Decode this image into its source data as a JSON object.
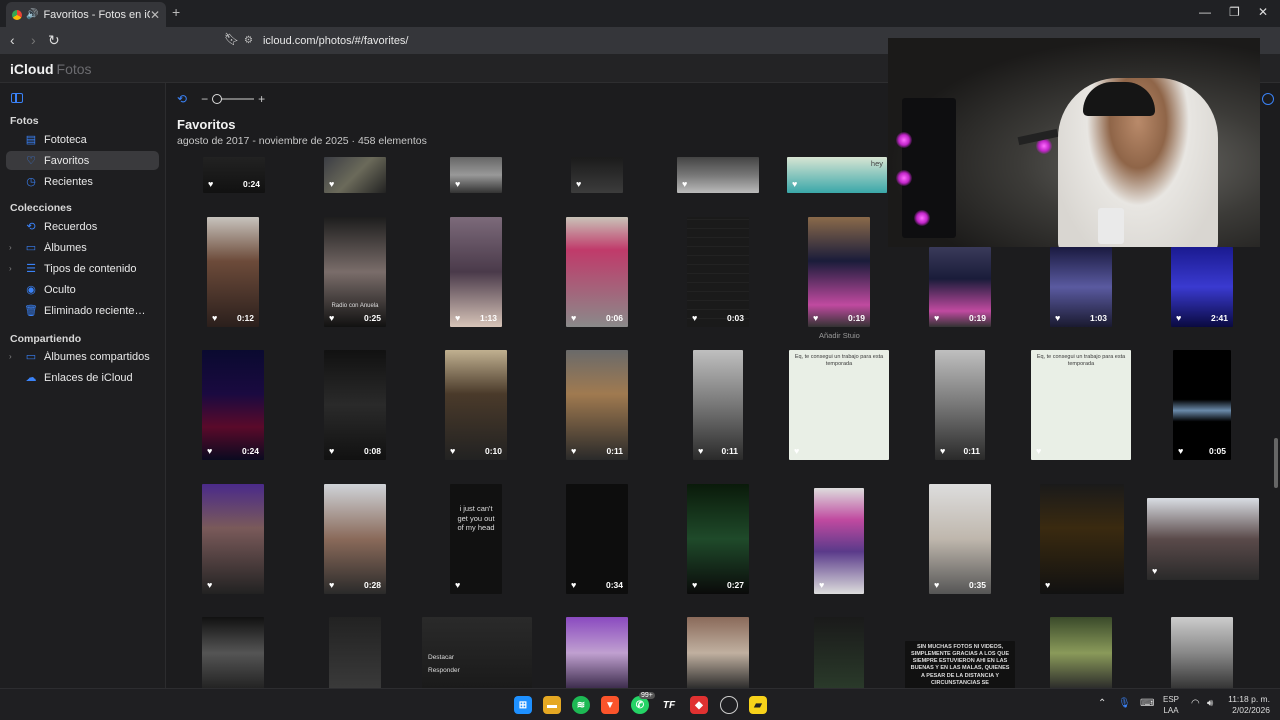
{
  "browser": {
    "tab_title": "Favoritos - Fotos en iCloud",
    "url": "icloud.com/photos/#/favorites/",
    "new_tab": "+",
    "win_min": "—",
    "win_restore": "❐",
    "win_close": "✕"
  },
  "app": {
    "brand": "iCloud",
    "brand_sub": "Fotos"
  },
  "sidebar": {
    "section_fotos": "Fotos",
    "section_colecciones": "Colecciones",
    "section_compartiendo": "Compartiendo",
    "items": [
      {
        "label": "Fototeca",
        "icon": "library-icon"
      },
      {
        "label": "Favoritos",
        "icon": "heart-icon"
      },
      {
        "label": "Recientes",
        "icon": "clock-icon"
      },
      {
        "label": "Recuerdos",
        "icon": "memories-icon"
      },
      {
        "label": "Álbumes",
        "icon": "album-icon"
      },
      {
        "label": "Tipos de contenido",
        "icon": "content-types-icon"
      },
      {
        "label": "Oculto",
        "icon": "eye-slash-icon"
      },
      {
        "label": "Eliminado recienteme...",
        "icon": "trash-icon"
      },
      {
        "label": "Álbumes compartidos",
        "icon": "shared-album-icon"
      },
      {
        "label": "Enlaces de iCloud",
        "icon": "cloud-link-icon"
      }
    ]
  },
  "main": {
    "title": "Favoritos",
    "subtitle": "agosto de 2017 - noviembre de 2025  ·  458 elementos",
    "hover_label": "Añadir Stuio",
    "zoom_minus": "−",
    "zoom_plus": "+",
    "heart": "♥",
    "durations": [
      "0:24",
      "0:12",
      "0:25",
      "1:13",
      "0:06",
      "0:03",
      "0:19",
      "0:19",
      "1:03",
      "2:41",
      "0:24",
      "0:08",
      "0:10",
      "0:11",
      "0:11",
      "0:11",
      "0:05",
      "0:28",
      "0:34",
      "0:27",
      "0:35"
    ],
    "thumb_texts": {
      "chat_heading": "Eq, te consegui un trabajo para esta temporada",
      "song_lyric": "i just can't get you out of my head",
      "caption_banner": "SIN MUCHAS FOTOS NI VIDEOS, SIMPLEMENTE GRACIAS A LOS QUE SIEMPRE ESTUVIERON AHI EN LAS BUENAS Y EN LAS MALAS, QUIENES A PESAR DE LA DISTANCIA Y CIRCUNSTANCIAS SE",
      "menu_destacar": "Destacar",
      "menu_responder": "Responder",
      "radio_caption": "Radio con Anuela",
      "hey": "hey"
    }
  },
  "taskbar": {
    "lang_line1": "ESP",
    "lang_line2": "LAA",
    "time": "11:18 p. m.",
    "date": "2/02/2026",
    "whatsapp_badge": "99+"
  },
  "colors": {
    "accent": "#3a82f7",
    "bg": "#1c1c1e",
    "sidebar_bg": "#1e1e20"
  }
}
